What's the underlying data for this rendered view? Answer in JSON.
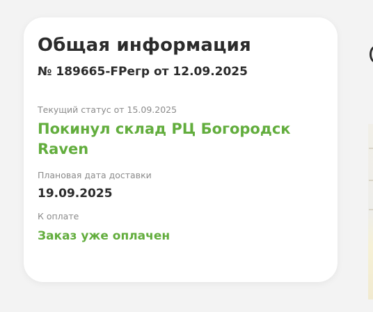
{
  "card": {
    "title": "Общая информация",
    "order_line": "№ 189665-FPегр от 12.09.2025",
    "status_label": "Текущий статус от 15.09.2025",
    "status_value": "Покинул склад РЦ Богородск Raven",
    "delivery_label": "Плановая дата доставки",
    "delivery_value": "19.09.2025",
    "payment_label": "К оплате",
    "payment_value": "Заказ уже оплачен"
  },
  "colors": {
    "accent_green": "#62ad3d",
    "text_dark": "#2b2b2b",
    "text_muted": "#8a8a8a",
    "card_bg": "#ffffff",
    "page_bg": "#f3f3f3"
  }
}
